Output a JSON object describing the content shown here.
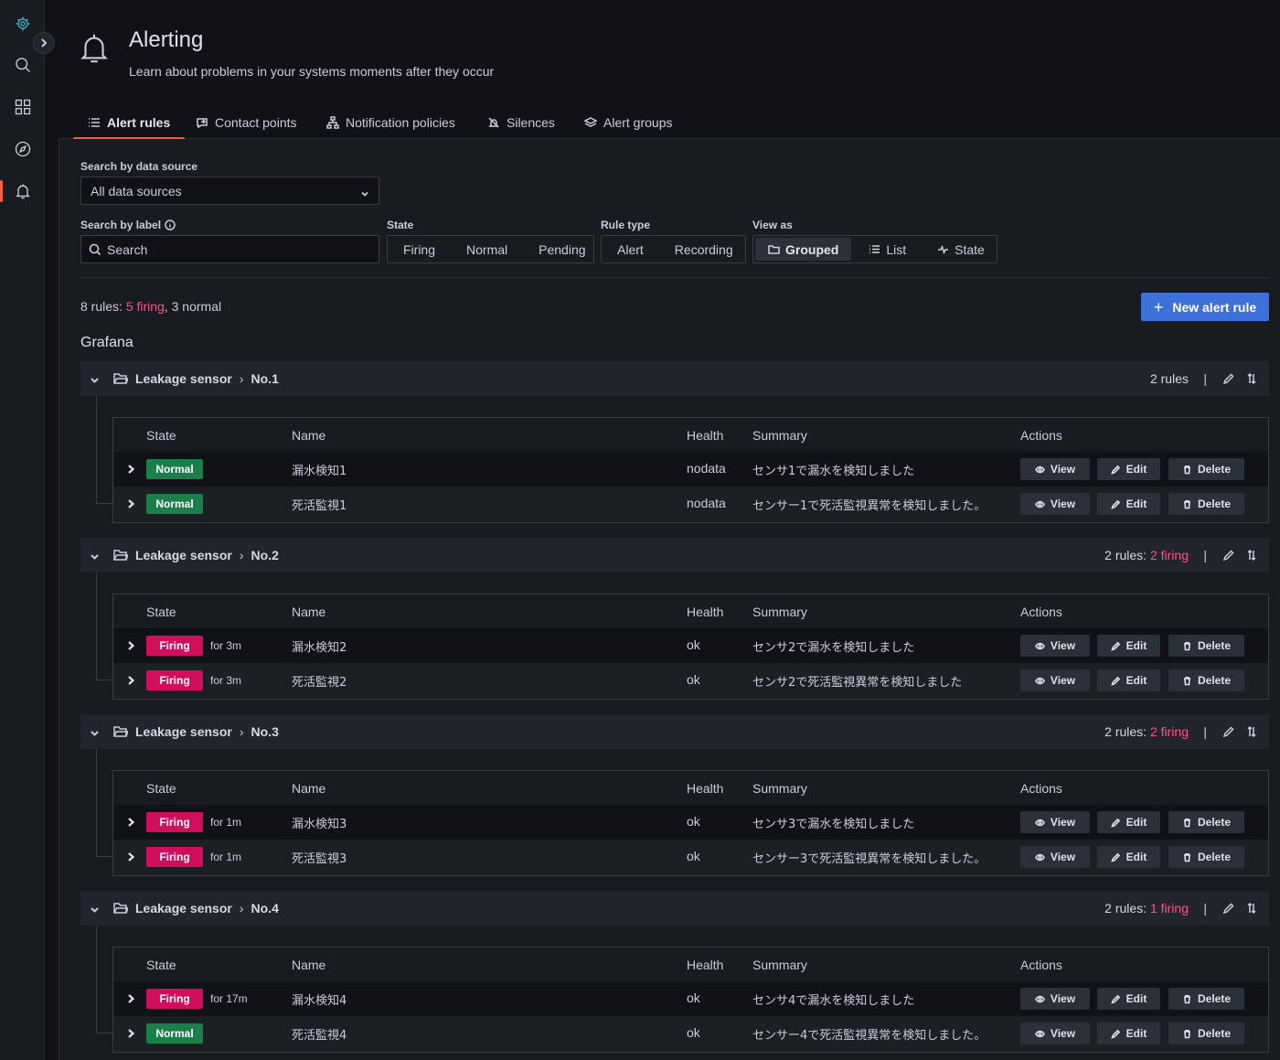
{
  "nav": {
    "logo_icon": "grafana-logo",
    "items": [
      "search-icon",
      "dashboards-icon",
      "explore-icon",
      "alerting-icon"
    ]
  },
  "header": {
    "title": "Alerting",
    "subtitle": "Learn about problems in your systems moments after they occur"
  },
  "tabs": [
    {
      "label": "Alert rules",
      "icon": "list-icon",
      "active": true
    },
    {
      "label": "Contact points",
      "icon": "comment-alt-share-icon"
    },
    {
      "label": "Notification policies",
      "icon": "sitemap-icon"
    },
    {
      "label": "Silences",
      "icon": "bell-slash-icon"
    },
    {
      "label": "Alert groups",
      "icon": "layer-group-icon"
    }
  ],
  "filters": {
    "datasource_label": "Search by data source",
    "datasource_value": "All data sources",
    "label_label": "Search by label",
    "search_placeholder": "Search",
    "state_label": "State",
    "state_options": [
      "Firing",
      "Normal",
      "Pending"
    ],
    "ruletype_label": "Rule type",
    "ruletype_options": [
      "Alert",
      "Recording"
    ],
    "viewas_label": "View as",
    "viewas_options": [
      "Grouped",
      "List",
      "State"
    ],
    "viewas_selected": "Grouped"
  },
  "summary": {
    "prefix": "8 rules: ",
    "firing": "5 firing",
    "sep": ", ",
    "normal": "3 normal"
  },
  "new_rule_button": "New alert rule",
  "section_title": "Grafana",
  "table_headers": {
    "state": "State",
    "name": "Name",
    "health": "Health",
    "summary": "Summary",
    "actions": "Actions"
  },
  "action_labels": {
    "view": "View",
    "edit": "Edit",
    "delete": "Delete"
  },
  "groups": [
    {
      "folder": "Leakage sensor",
      "group": "No.1",
      "count_prefix": "2 rules",
      "firing": "",
      "rules": [
        {
          "state": "Normal",
          "for": "",
          "name": "漏水検知1",
          "health": "nodata",
          "summary": "センサ1で漏水を検知しました"
        },
        {
          "state": "Normal",
          "for": "",
          "name": "死活監視1",
          "health": "nodata",
          "summary": "センサー1で死活監視異常を検知しました。"
        }
      ]
    },
    {
      "folder": "Leakage sensor",
      "group": "No.2",
      "count_prefix": "2 rules: ",
      "firing": "2 firing",
      "rules": [
        {
          "state": "Firing",
          "for": "for 3m",
          "name": "漏水検知2",
          "health": "ok",
          "summary": "センサ2で漏水を検知しました"
        },
        {
          "state": "Firing",
          "for": "for 3m",
          "name": "死活監視2",
          "health": "ok",
          "summary": "センサ2で死活監視異常を検知しました"
        }
      ]
    },
    {
      "folder": "Leakage sensor",
      "group": "No.3",
      "count_prefix": "2 rules: ",
      "firing": "2 firing",
      "rules": [
        {
          "state": "Firing",
          "for": "for 1m",
          "name": "漏水検知3",
          "health": "ok",
          "summary": "センサ3で漏水を検知しました"
        },
        {
          "state": "Firing",
          "for": "for 1m",
          "name": "死活監視3",
          "health": "ok",
          "summary": "センサー3で死活監視異常を検知しました。"
        }
      ]
    },
    {
      "folder": "Leakage sensor",
      "group": "No.4",
      "count_prefix": "2 rules: ",
      "firing": "1 firing",
      "rules": [
        {
          "state": "Firing",
          "for": "for 17m",
          "name": "漏水検知4",
          "health": "ok",
          "summary": "センサ4で漏水を検知しました"
        },
        {
          "state": "Normal",
          "for": "",
          "name": "死活監視4",
          "health": "ok",
          "summary": "センサー4で死活監視異常を検知しました。"
        }
      ]
    }
  ],
  "colors": {
    "accent": "#f55f3e",
    "primary_button": "#3d71d9",
    "normal_badge": "#1a7f4b",
    "firing_badge": "#d10e5c",
    "firing_text": "#ff5286"
  }
}
